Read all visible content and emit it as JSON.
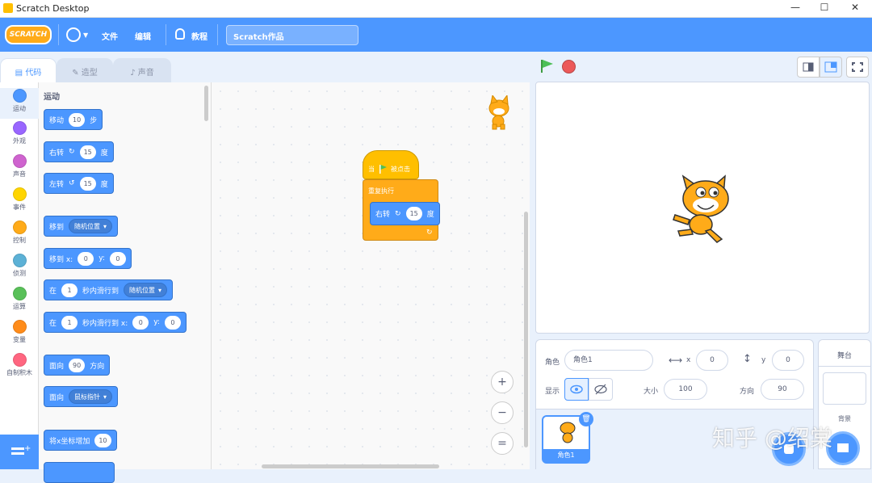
{
  "window": {
    "title": "Scratch Desktop",
    "min": "—",
    "max": "☐",
    "close": "✕"
  },
  "menubar": {
    "logo": "SCRATCH",
    "file": "文件",
    "edit": "编辑",
    "tutorials": "教程",
    "project_title": "Scratch作品"
  },
  "tabs": [
    {
      "label": "代码",
      "icon": "code-icon"
    },
    {
      "label": "造型",
      "icon": "brush-icon"
    },
    {
      "label": "声音",
      "icon": "sound-icon"
    }
  ],
  "categories": [
    {
      "label": "运动",
      "color": "#4c97ff"
    },
    {
      "label": "外观",
      "color": "#9966ff"
    },
    {
      "label": "声音",
      "color": "#cf63cf"
    },
    {
      "label": "事件",
      "color": "#ffd500"
    },
    {
      "label": "控制",
      "color": "#ffab19"
    },
    {
      "label": "侦测",
      "color": "#5cb1d6"
    },
    {
      "label": "运算",
      "color": "#59c059"
    },
    {
      "label": "变量",
      "color": "#ff8c1a"
    },
    {
      "label": "自制积木",
      "color": "#ff6680"
    }
  ],
  "palette": {
    "heading": "运动",
    "move": {
      "a": "移动",
      "v": "10",
      "b": "步"
    },
    "turn_right": {
      "a": "右转",
      "v": "15",
      "b": "度"
    },
    "turn_left": {
      "a": "左转",
      "v": "15",
      "b": "度"
    },
    "goto": {
      "a": "移到",
      "d": "随机位置"
    },
    "goto_xy": {
      "a": "移到 x:",
      "x": "0",
      "b": "y:",
      "y": "0"
    },
    "glide": {
      "a": "在",
      "v": "1",
      "b": "秒内滑行到",
      "d": "随机位置"
    },
    "glide_xy": {
      "a": "在",
      "v": "1",
      "b": "秒内滑行到 x:",
      "x": "0",
      "c": "y:",
      "y": "0"
    },
    "point_dir": {
      "a": "面向",
      "v": "90",
      "b": "方向"
    },
    "point_towards": {
      "a": "面向",
      "d": "鼠标指针"
    },
    "change_x": {
      "a": "将x坐标增加",
      "v": "10"
    }
  },
  "script": {
    "hat_a": "当",
    "hat_b": "被点击",
    "forever": "重复执行",
    "turn": "右转",
    "turn_v": "15",
    "turn_b": "度"
  },
  "zoom": {
    "in": "+",
    "out": "−",
    "reset": "="
  },
  "sprite_info": {
    "sprite_label": "角色",
    "sprite_name": "角色1",
    "x_label": "x",
    "x": "0",
    "y_label": "y",
    "y": "0",
    "show_label": "显示",
    "size_label": "大小",
    "size": "100",
    "dir_label": "方向",
    "direction": "90"
  },
  "sprites": [
    {
      "name": "角色1"
    }
  ],
  "stage_pane": {
    "title": "舞台",
    "backdrop_label": "背景"
  },
  "watermark": "知乎 @绍棠",
  "colors": {
    "motion": "#4c97ff",
    "events": "#ffbf00",
    "control": "#ffab19",
    "accent": "#4c97ff",
    "green_flag": "#4cbf56",
    "stop": "#ec5959"
  }
}
